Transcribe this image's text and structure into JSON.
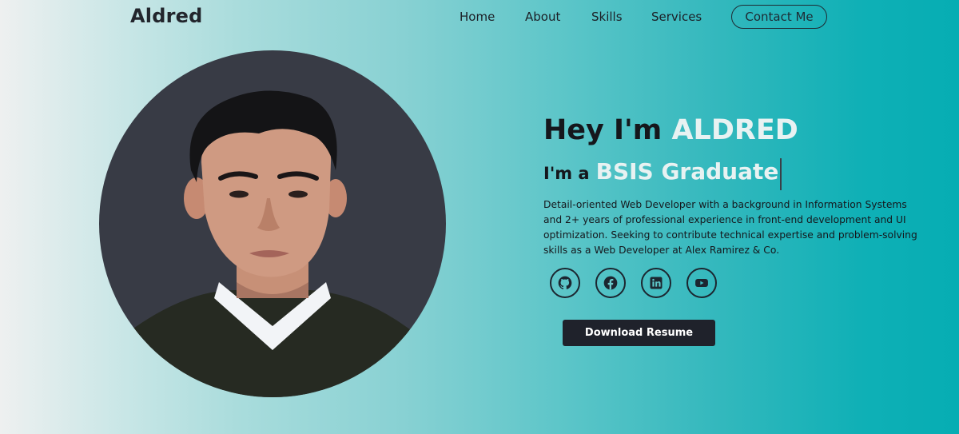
{
  "brand": {
    "logo_text": "Aldred"
  },
  "nav": {
    "items": [
      {
        "label": "Home"
      },
      {
        "label": "About"
      },
      {
        "label": "Skills"
      },
      {
        "label": "Services"
      }
    ],
    "contact_label": "Contact Me"
  },
  "hero": {
    "greeting": "Hey I'm ",
    "name": "ALDRED",
    "role_prefix": "I'm a",
    "role_typed": "BSIS Graduate",
    "description": "Detail-oriented Web Developer with a background in Information Systems and 2+ years of professional experience in front-end development and UI optimization. Seeking to contribute technical expertise and problem-solving skills as a Web Developer at Alex Ramirez & Co.",
    "download_label": "Download Resume"
  },
  "socials": [
    {
      "icon": "github-icon"
    },
    {
      "icon": "facebook-icon"
    },
    {
      "icon": "linkedin-icon"
    },
    {
      "icon": "youtube-icon"
    }
  ],
  "colors": {
    "accent_text": "#e8f2f2",
    "dark": "#1f222b",
    "photo_bg": "#383b45",
    "gradient_end": "#06adb3"
  }
}
